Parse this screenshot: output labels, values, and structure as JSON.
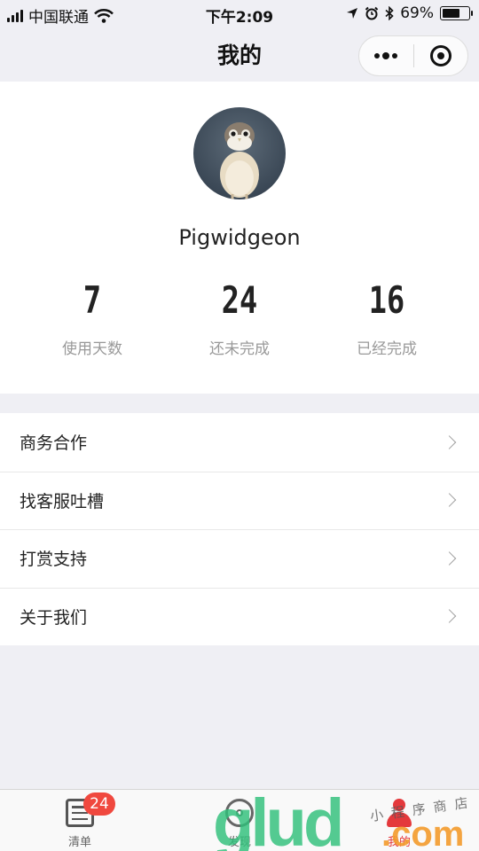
{
  "status_bar": {
    "carrier": "中国联通",
    "time": "下午2:09",
    "battery": "69%",
    "battery_level": 0.69
  },
  "nav": {
    "title": "我的"
  },
  "profile": {
    "username": "Pigwidgeon",
    "stats": [
      {
        "value": "7",
        "label": "使用天数"
      },
      {
        "value": "24",
        "label": "还未完成"
      },
      {
        "value": "16",
        "label": "已经完成"
      }
    ]
  },
  "menu": {
    "items": [
      {
        "label": "商务合作"
      },
      {
        "label": "找客服吐槽"
      },
      {
        "label": "打赏支持"
      },
      {
        "label": "关于我们"
      }
    ]
  },
  "tabs": [
    {
      "label": "清单",
      "badge": "24",
      "icon": "list-icon"
    },
    {
      "label": "发现",
      "icon": "compass-icon"
    },
    {
      "label": "我的",
      "icon": "person-icon",
      "active": true
    }
  ],
  "watermark": {
    "text": "glud",
    "domain": ".com",
    "tagline": "小程序商店"
  },
  "colors": {
    "accent": "#e4393c",
    "badge": "#f0483e",
    "background": "#efeff4",
    "watermark_green": "#2fc07a",
    "watermark_orange": "#f39a2b"
  }
}
